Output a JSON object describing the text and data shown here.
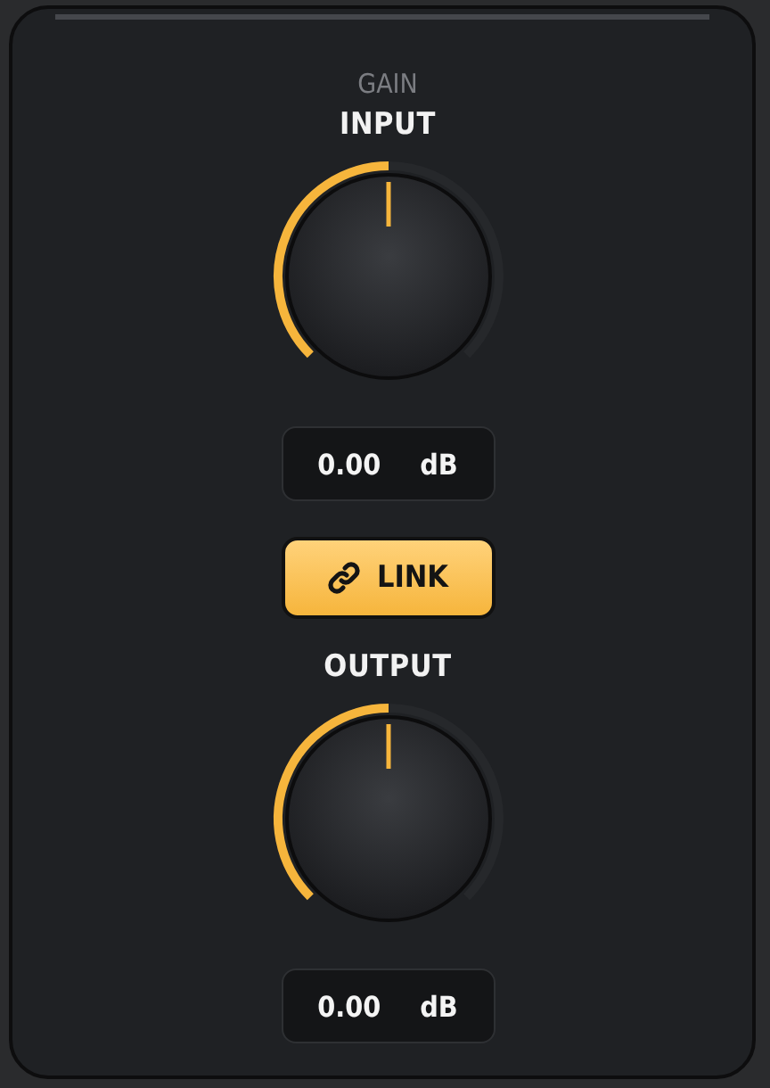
{
  "section": "GAIN",
  "channels": [
    {
      "label": "INPUT",
      "value": "0.00",
      "unit": "dB"
    },
    {
      "label": "OUTPUT",
      "value": "0.00",
      "unit": "dB"
    }
  ],
  "link": {
    "label": "LINK",
    "on": true
  }
}
